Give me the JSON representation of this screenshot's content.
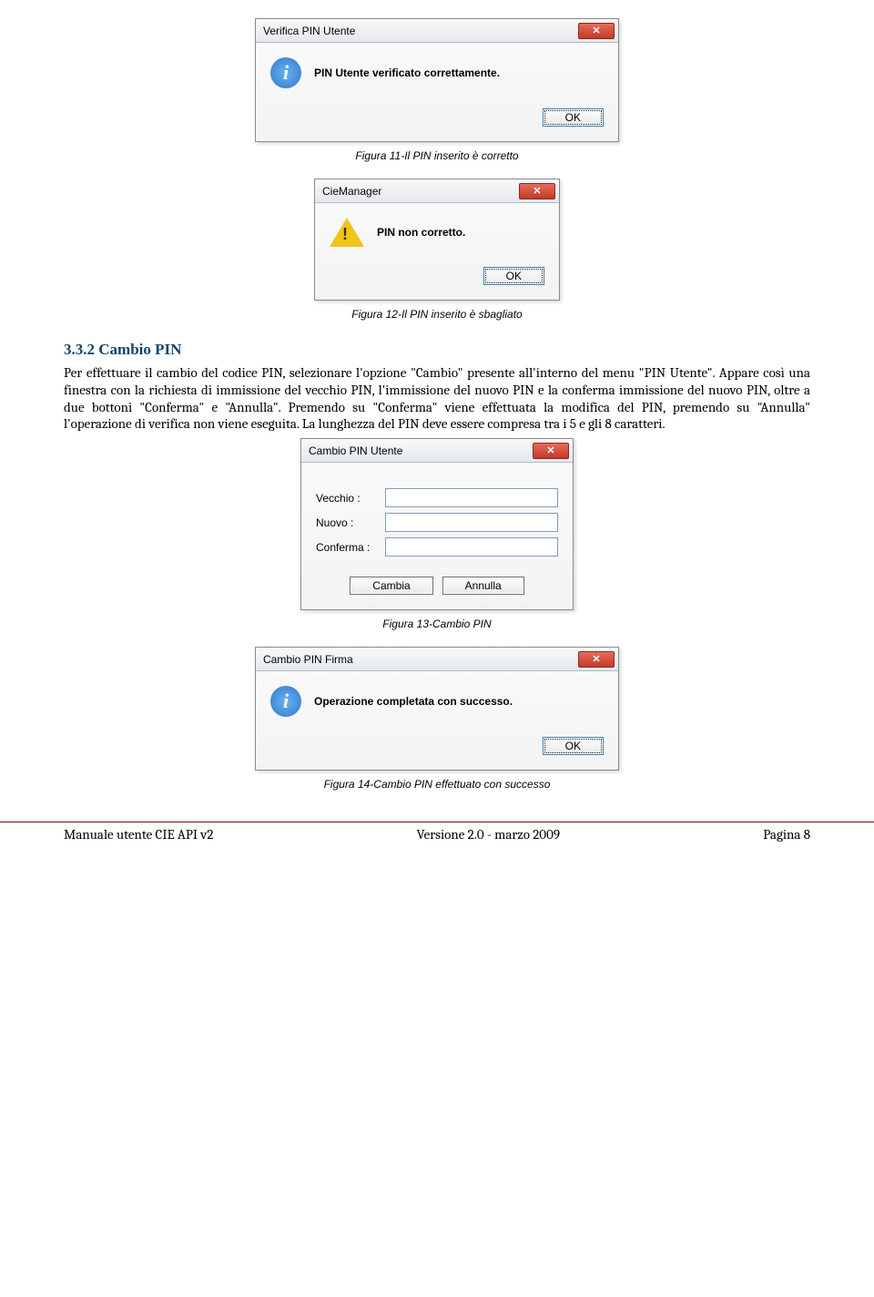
{
  "dialog1": {
    "title": "Verifica PIN Utente",
    "message": "PIN Utente verificato correttamente.",
    "ok": "OK"
  },
  "caption1": "Figura 11-Il PIN inserito è corretto",
  "dialog2": {
    "title": "CieManager",
    "message": "PIN non corretto.",
    "ok": "OK"
  },
  "caption2": "Figura 12-Il PIN inserito è sbagliato",
  "section": {
    "number_title": "3.3.2   Cambio PIN",
    "para": "Per effettuare il cambio del codice PIN, selezionare l'opzione \"Cambio\" presente all'interno del menu \"PIN Utente\". Appare così una finestra con la richiesta di immissione del vecchio PIN, l'immissione del nuovo PIN e la conferma immissione del nuovo PIN, oltre a due bottoni \"Conferma\" e \"Annulla\". Premendo su \"Conferma\" viene effettuata la modifica del PIN, premendo su \"Annulla\" l'operazione di verifica non viene eseguita. La lunghezza del PIN deve essere compresa tra i 5 e gli 8 caratteri."
  },
  "dialog3": {
    "title": "Cambio PIN Utente",
    "labels": {
      "vecchio": "Vecchio :",
      "nuovo": "Nuovo :",
      "conferma": "Conferma :"
    },
    "buttons": {
      "cambia": "Cambia",
      "annulla": "Annulla"
    }
  },
  "caption3": "Figura 13-Cambio PIN",
  "dialog4": {
    "title": "Cambio PIN Firma",
    "message": "Operazione completata con successo.",
    "ok": "OK"
  },
  "caption4": "Figura 14-Cambio PIN effettuato con successo",
  "footer": {
    "left": "Manuale utente CIE API v2",
    "center": "Versione 2.0 - marzo 2009",
    "right": "Pagina 8"
  }
}
